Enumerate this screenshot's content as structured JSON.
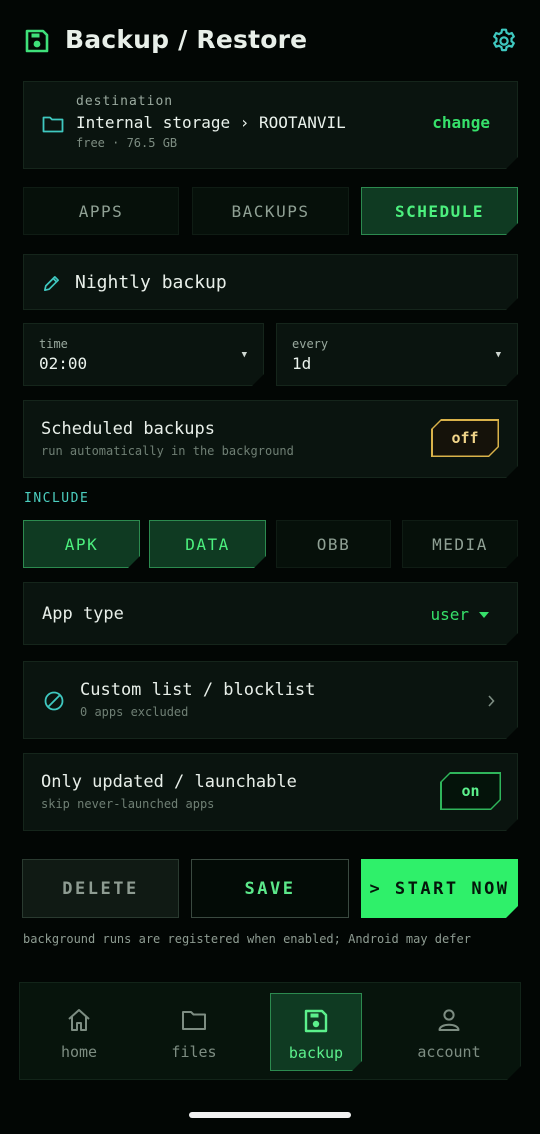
{
  "header": {
    "title": "Backup / Restore",
    "icon": "floppy-disk-icon",
    "settings_icon": "gear-icon"
  },
  "destination": {
    "label": "destination",
    "path": "Internal storage › ROOTANVIL",
    "free": "free · 76.5 GB",
    "change_label": "change"
  },
  "tabs": [
    {
      "label": "APPS",
      "active": false
    },
    {
      "label": "BACKUPS",
      "active": false
    },
    {
      "label": "SCHEDULE",
      "active": true
    }
  ],
  "schedule": {
    "name": "Nightly backup",
    "time": {
      "label": "time",
      "value": "02:00"
    },
    "every": {
      "label": "every",
      "value": "1d"
    },
    "enabled_row": {
      "title": "Scheduled backups",
      "subtitle": "run automatically in the background",
      "toggle": "off"
    }
  },
  "include": {
    "label": "INCLUDE",
    "options": [
      {
        "label": "APK",
        "on": true
      },
      {
        "label": "DATA",
        "on": true
      },
      {
        "label": "OBB",
        "on": false
      },
      {
        "label": "MEDIA",
        "on": false
      }
    ]
  },
  "app_type": {
    "title": "App type",
    "value": "user"
  },
  "custom_list": {
    "title": "Custom list / blocklist",
    "subtitle": "0 apps excluded"
  },
  "updated_row": {
    "title": "Only updated / launchable",
    "subtitle": "skip never-launched apps",
    "toggle": "on"
  },
  "actions": {
    "delete": "DELETE",
    "save": "SAVE",
    "start": "> START NOW"
  },
  "notice": "background runs are registered when enabled; Android may defer",
  "nav": [
    {
      "label": "home",
      "icon": "home-icon",
      "active": false
    },
    {
      "label": "files",
      "icon": "folder-icon",
      "active": false
    },
    {
      "label": "backup",
      "icon": "floppy-disk-icon",
      "active": true
    },
    {
      "label": "account",
      "icon": "person-icon",
      "active": false
    }
  ],
  "colors": {
    "accent": "#36e06a",
    "warning": "#d9b24a",
    "teal": "#3fc8c0",
    "background": "#020604"
  }
}
